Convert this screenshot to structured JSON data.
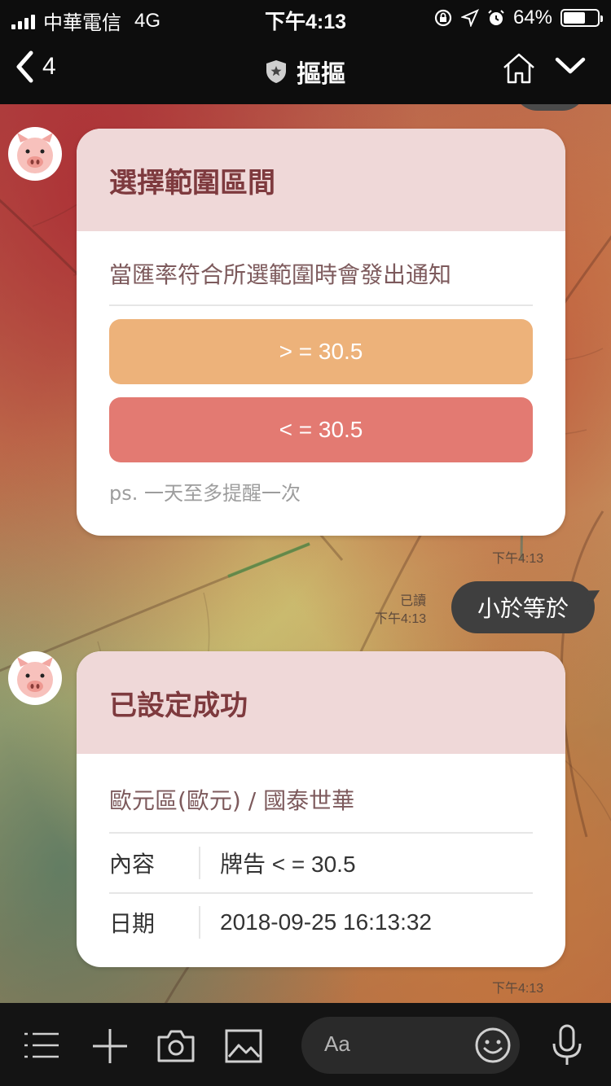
{
  "status_bar": {
    "carrier": "中華電信",
    "network": "4G",
    "time": "下午4:13",
    "battery_percent": "64%",
    "battery_level": 0.64,
    "icons": [
      "signal-icon",
      "lock-rotation-icon",
      "location-arrow-icon",
      "alarm-icon",
      "battery-icon"
    ]
  },
  "nav": {
    "back_count": "4",
    "title": "摳摳",
    "icons": [
      "back-chevron-icon",
      "shield-star-icon",
      "home-icon",
      "chevron-down-icon"
    ]
  },
  "messages": {
    "card1": {
      "title": "選擇範圍區間",
      "description": "當匯率符合所選範圍時會發出通知",
      "option_gte": "> = 30.5",
      "option_lte": "< = 30.5",
      "note": "ps. 一天至多提醒一次",
      "time": "下午4:13",
      "colors": {
        "header": "#efd8d8",
        "gte": "#edb27a",
        "lte": "#e37a72"
      }
    },
    "user_reply": {
      "text": "小於等於",
      "read": "已讀",
      "time": "下午4:13"
    },
    "card2": {
      "title": "已設定成功",
      "subtitle": "歐元區(歐元) / 國泰世華",
      "rows": [
        {
          "label": "內容",
          "value": "牌告 < = 30.5"
        },
        {
          "label": "日期",
          "value": "2018-09-25 16:13:32"
        }
      ],
      "time": "下午4:13"
    }
  },
  "input_bar": {
    "placeholder": "Aa",
    "icons": [
      "menu-icon",
      "plus-icon",
      "camera-icon",
      "image-icon",
      "emoji-icon",
      "microphone-icon"
    ]
  }
}
